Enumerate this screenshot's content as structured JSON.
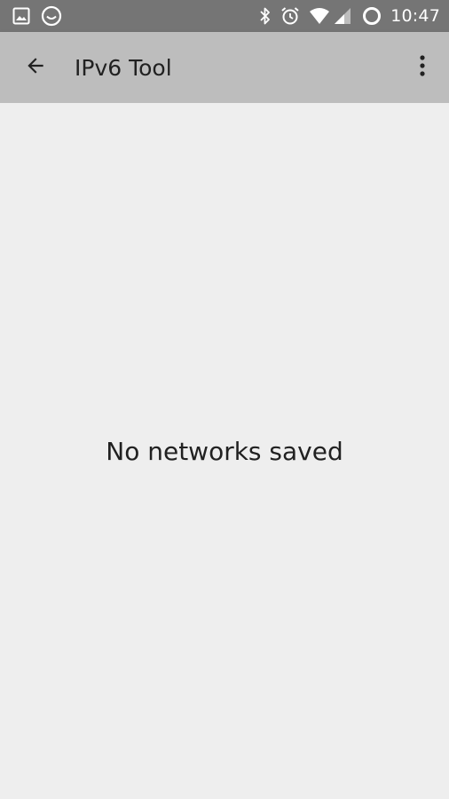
{
  "status_bar": {
    "time": "10:47",
    "icons_left": [
      "image-notification-icon",
      "smiley-notification-icon"
    ],
    "icons_right": [
      "bluetooth-icon",
      "alarm-icon",
      "wifi-icon",
      "cell-signal-icon",
      "sync-icon"
    ]
  },
  "app_bar": {
    "title": "IPv6 Tool",
    "back_icon": "arrow-back-icon",
    "menu_icon": "more-vert-icon"
  },
  "content": {
    "empty_message": "No networks saved"
  },
  "colors": {
    "status_bar_bg": "#757575",
    "app_bar_bg": "#bdbdbd",
    "background": "#eeeeee",
    "text": "#212121"
  }
}
